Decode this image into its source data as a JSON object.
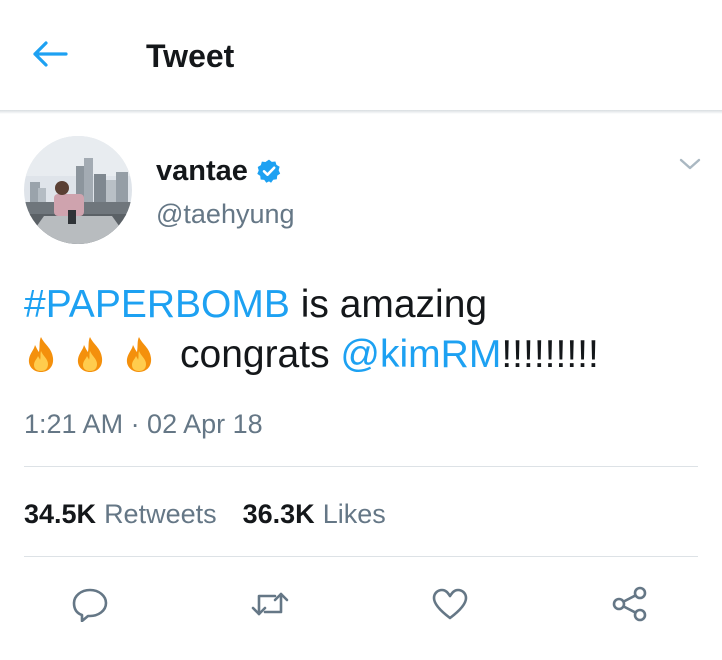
{
  "header": {
    "title": "Tweet",
    "back_icon": "arrow-left-icon",
    "accent_color": "#1da1f2"
  },
  "tweet": {
    "author": {
      "display_name": "vantae",
      "verified": true,
      "handle": "@taehyung"
    },
    "text": {
      "hashtag": "#PAPERBOMB",
      "line1_rest": " is amazing",
      "emojis": [
        "fire-emoji",
        "fire-emoji",
        "fire-emoji"
      ],
      "line2_text": "congrats ",
      "mention": "@kimRM",
      "trailing": "!!!!!!!!!"
    },
    "timestamp": "1:21 AM · 02 Apr 18",
    "stats": {
      "retweets_count": "34.5K",
      "retweets_label": "Retweets",
      "likes_count": "36.3K",
      "likes_label": "Likes"
    }
  },
  "actions": [
    {
      "name": "reply",
      "icon": "reply-icon"
    },
    {
      "name": "retweet",
      "icon": "retweet-icon"
    },
    {
      "name": "like",
      "icon": "heart-icon"
    },
    {
      "name": "share",
      "icon": "share-icon"
    }
  ],
  "colors": {
    "text_primary": "#14171a",
    "text_secondary": "#657786",
    "link": "#1da1f2",
    "divider": "#dde2e6"
  }
}
